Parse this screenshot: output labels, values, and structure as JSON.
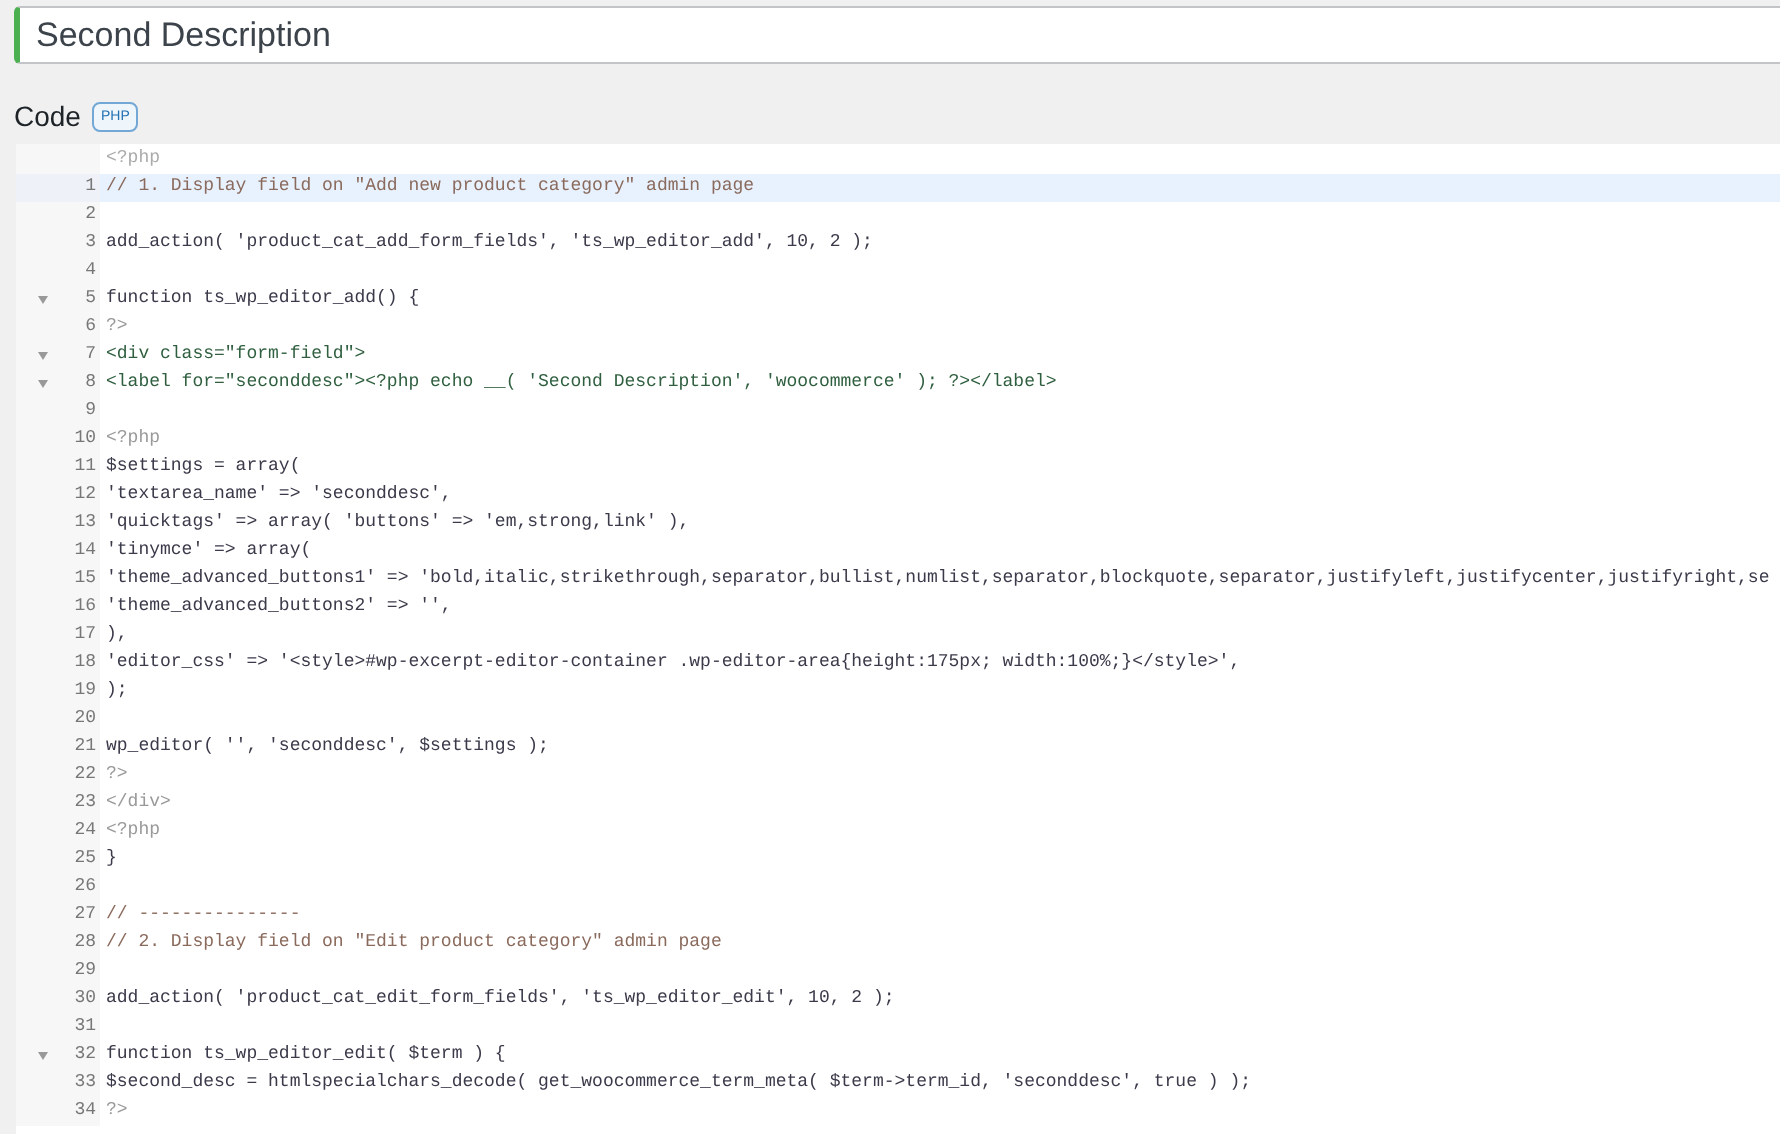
{
  "title_field": {
    "value": "Second Description"
  },
  "code_section": {
    "label": "Code",
    "language_badge": "PHP"
  },
  "editor": {
    "header": "<?php",
    "lines": [
      {
        "number": "1",
        "text": "// 1. Display field on \"Add new product category\" admin page",
        "kind": "comment",
        "active": true,
        "foldable": false
      },
      {
        "number": "2",
        "active": false,
        "foldable": false
      },
      {
        "number": "3",
        "text": "add_action( 'product_cat_add_form_fields', 'ts_wp_editor_add', 10, 2 );",
        "kind": "code",
        "active": false,
        "foldable": false
      },
      {
        "number": "4",
        "active": false,
        "foldable": false
      },
      {
        "number": "5",
        "text": "function ts_wp_editor_add() {",
        "kind": "code",
        "active": false,
        "foldable": true
      },
      {
        "number": "6",
        "text": "?>",
        "kind": "tag",
        "active": false,
        "foldable": false
      },
      {
        "number": "7",
        "text": "<div class=\"form-field\">",
        "kind": "markup",
        "active": false,
        "foldable": true
      },
      {
        "number": "8",
        "text": "<label for=\"seconddesc\"><?php echo __( 'Second Description', 'woocommerce' ); ?></label>",
        "kind": "markup",
        "active": false,
        "foldable": true
      },
      {
        "number": "9",
        "active": false,
        "foldable": false
      },
      {
        "number": "10",
        "text": "<?php",
        "kind": "tag",
        "active": false,
        "foldable": false
      },
      {
        "number": "11",
        "text": "$settings = array(",
        "kind": "code",
        "active": false,
        "foldable": false
      },
      {
        "number": "12",
        "text": "'textarea_name' => 'seconddesc',",
        "kind": "code",
        "active": false,
        "foldable": false
      },
      {
        "number": "13",
        "text": "'quicktags' => array( 'buttons' => 'em,strong,link' ),",
        "kind": "code",
        "active": false,
        "foldable": false
      },
      {
        "number": "14",
        "text": "'tinymce' => array(",
        "kind": "code",
        "active": false,
        "foldable": false
      },
      {
        "number": "15",
        "text": "'theme_advanced_buttons1' => 'bold,italic,strikethrough,separator,bullist,numlist,separator,blockquote,separator,justifyleft,justifycenter,justifyright,se",
        "kind": "code",
        "active": false,
        "foldable": false
      },
      {
        "number": "16",
        "text": "'theme_advanced_buttons2' => '',",
        "kind": "code",
        "active": false,
        "foldable": false
      },
      {
        "number": "17",
        "text": "),",
        "kind": "code",
        "active": false,
        "foldable": false
      },
      {
        "number": "18",
        "text": "'editor_css' => '<style>#wp-excerpt-editor-container .wp-editor-area{height:175px; width:100%;}</style>',",
        "kind": "code",
        "active": false,
        "foldable": false
      },
      {
        "number": "19",
        "text": ");",
        "kind": "code",
        "active": false,
        "foldable": false
      },
      {
        "number": "20",
        "active": false,
        "foldable": false
      },
      {
        "number": "21",
        "text": "wp_editor( '', 'seconddesc', $settings );",
        "kind": "code",
        "active": false,
        "foldable": false
      },
      {
        "number": "22",
        "text": "?>",
        "kind": "tag",
        "active": false,
        "foldable": false
      },
      {
        "number": "23",
        "text": "</div>",
        "kind": "tag",
        "active": false,
        "foldable": false
      },
      {
        "number": "24",
        "text": "<?php",
        "kind": "tag",
        "active": false,
        "foldable": false
      },
      {
        "number": "25",
        "text": "}",
        "kind": "code",
        "active": false,
        "foldable": false
      },
      {
        "number": "26",
        "active": false,
        "foldable": false
      },
      {
        "number": "27",
        "text": "// ---------------",
        "kind": "comment",
        "active": false,
        "foldable": false
      },
      {
        "number": "28",
        "text": "// 2. Display field on \"Edit product category\" admin page",
        "kind": "comment",
        "active": false,
        "foldable": false
      },
      {
        "number": "29",
        "active": false,
        "foldable": false
      },
      {
        "number": "30",
        "text": "add_action( 'product_cat_edit_form_fields', 'ts_wp_editor_edit', 10, 2 );",
        "kind": "code",
        "active": false,
        "foldable": false
      },
      {
        "number": "31",
        "active": false,
        "foldable": false
      },
      {
        "number": "32",
        "text": "function ts_wp_editor_edit( $term ) {",
        "kind": "code",
        "active": false,
        "foldable": true
      },
      {
        "number": "33",
        "text": "$second_desc = htmlspecialchars_decode( get_woocommerce_term_meta( $term->term_id, 'seconddesc', true ) );",
        "kind": "code",
        "active": false,
        "foldable": false
      },
      {
        "number": "34",
        "text": "?>",
        "kind": "tag",
        "active": false,
        "foldable": false
      }
    ]
  }
}
